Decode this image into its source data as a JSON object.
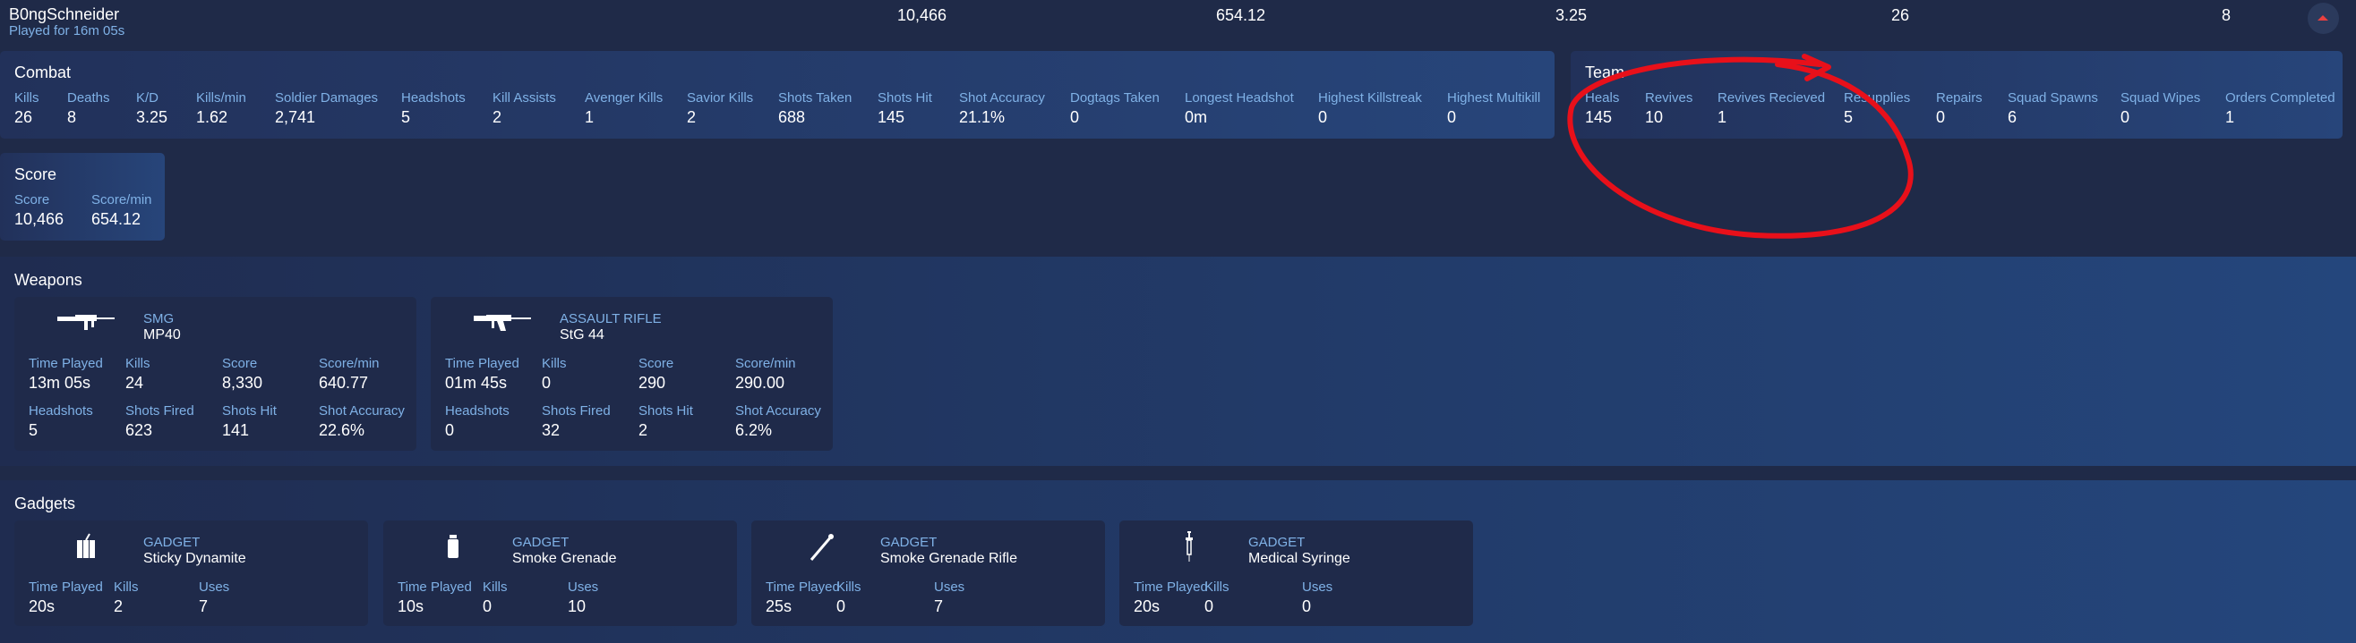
{
  "header": {
    "player_name": "B0ngSchneider",
    "played_for": "Played for 16m 05s",
    "score": "10,466",
    "score_per_min": "654.12",
    "kd": "3.25",
    "kills": "26",
    "deaths": "8"
  },
  "combat": {
    "title": "Combat",
    "stats": [
      {
        "label": "Kills",
        "value": "26"
      },
      {
        "label": "Deaths",
        "value": "8"
      },
      {
        "label": "K/D",
        "value": "3.25"
      },
      {
        "label": "Kills/min",
        "value": "1.62"
      },
      {
        "label": "Soldier Damages",
        "value": "2,741"
      },
      {
        "label": "Headshots",
        "value": "5"
      },
      {
        "label": "Kill Assists",
        "value": "2"
      },
      {
        "label": "Avenger Kills",
        "value": "1"
      },
      {
        "label": "Savior Kills",
        "value": "2"
      },
      {
        "label": "Shots Taken",
        "value": "688"
      },
      {
        "label": "Shots Hit",
        "value": "145"
      },
      {
        "label": "Shot Accuracy",
        "value": "21.1%"
      },
      {
        "label": "Dogtags Taken",
        "value": "0"
      },
      {
        "label": "Longest Headshot",
        "value": "0m"
      },
      {
        "label": "Highest Killstreak",
        "value": "0"
      },
      {
        "label": "Highest Multikill",
        "value": "0"
      }
    ]
  },
  "team": {
    "title": "Team",
    "stats": [
      {
        "label": "Heals",
        "value": "145"
      },
      {
        "label": "Revives",
        "value": "10"
      },
      {
        "label": "Revives Recieved",
        "value": "1"
      },
      {
        "label": "Resupplies",
        "value": "5"
      },
      {
        "label": "Repairs",
        "value": "0"
      },
      {
        "label": "Squad Spawns",
        "value": "6"
      },
      {
        "label": "Squad Wipes",
        "value": "0"
      },
      {
        "label": "Orders Completed",
        "value": "1"
      }
    ]
  },
  "score": {
    "title": "Score",
    "stats": [
      {
        "label": "Score",
        "value": "10,466"
      },
      {
        "label": "Score/min",
        "value": "654.12"
      }
    ]
  },
  "weapons": {
    "title": "Weapons",
    "cards": [
      {
        "category": "SMG",
        "name": "MP40",
        "icon": "smg-icon",
        "stats": [
          {
            "label": "Time Played",
            "value": "13m 05s"
          },
          {
            "label": "Kills",
            "value": "24"
          },
          {
            "label": "Score",
            "value": "8,330"
          },
          {
            "label": "Score/min",
            "value": "640.77"
          },
          {
            "label": "Headshots",
            "value": "5"
          },
          {
            "label": "Shots Fired",
            "value": "623"
          },
          {
            "label": "Shots Hit",
            "value": "141"
          },
          {
            "label": "Shot Accuracy",
            "value": "22.6%"
          }
        ]
      },
      {
        "category": "ASSAULT RIFLE",
        "name": "StG 44",
        "icon": "assault-rifle-icon",
        "stats": [
          {
            "label": "Time Played",
            "value": "01m 45s"
          },
          {
            "label": "Kills",
            "value": "0"
          },
          {
            "label": "Score",
            "value": "290"
          },
          {
            "label": "Score/min",
            "value": "290.00"
          },
          {
            "label": "Headshots",
            "value": "0"
          },
          {
            "label": "Shots Fired",
            "value": "32"
          },
          {
            "label": "Shots Hit",
            "value": "2"
          },
          {
            "label": "Shot Accuracy",
            "value": "6.2%"
          }
        ]
      }
    ]
  },
  "gadgets": {
    "title": "Gadgets",
    "cards": [
      {
        "category": "GADGET",
        "name": "Sticky Dynamite",
        "icon": "dynamite-icon",
        "stats": [
          {
            "label": "Time Played",
            "value": "20s"
          },
          {
            "label": "Kills",
            "value": "2"
          },
          {
            "label": "Uses",
            "value": "7"
          }
        ]
      },
      {
        "category": "GADGET",
        "name": "Smoke Grenade",
        "icon": "smoke-grenade-icon",
        "stats": [
          {
            "label": "Time Played",
            "value": "10s"
          },
          {
            "label": "Kills",
            "value": "0"
          },
          {
            "label": "Uses",
            "value": "10"
          }
        ]
      },
      {
        "category": "GADGET",
        "name": "Smoke Grenade Rifle",
        "icon": "grenade-rifle-icon",
        "stats": [
          {
            "label": "Time Played",
            "value": "25s"
          },
          {
            "label": "Kills",
            "value": "0"
          },
          {
            "label": "Uses",
            "value": "7"
          }
        ]
      },
      {
        "category": "GADGET",
        "name": "Medical Syringe",
        "icon": "syringe-icon",
        "stats": [
          {
            "label": "Time Played",
            "value": "20s"
          },
          {
            "label": "Kills",
            "value": "0"
          },
          {
            "label": "Uses",
            "value": "0"
          }
        ]
      }
    ]
  },
  "annotation": {
    "color": "#e8101a",
    "shape": "hand-drawn ellipse with arrow"
  },
  "colors": {
    "accent_label": "#7fb1e6",
    "background": "#1f2a48",
    "card": "#1f2a4a"
  }
}
